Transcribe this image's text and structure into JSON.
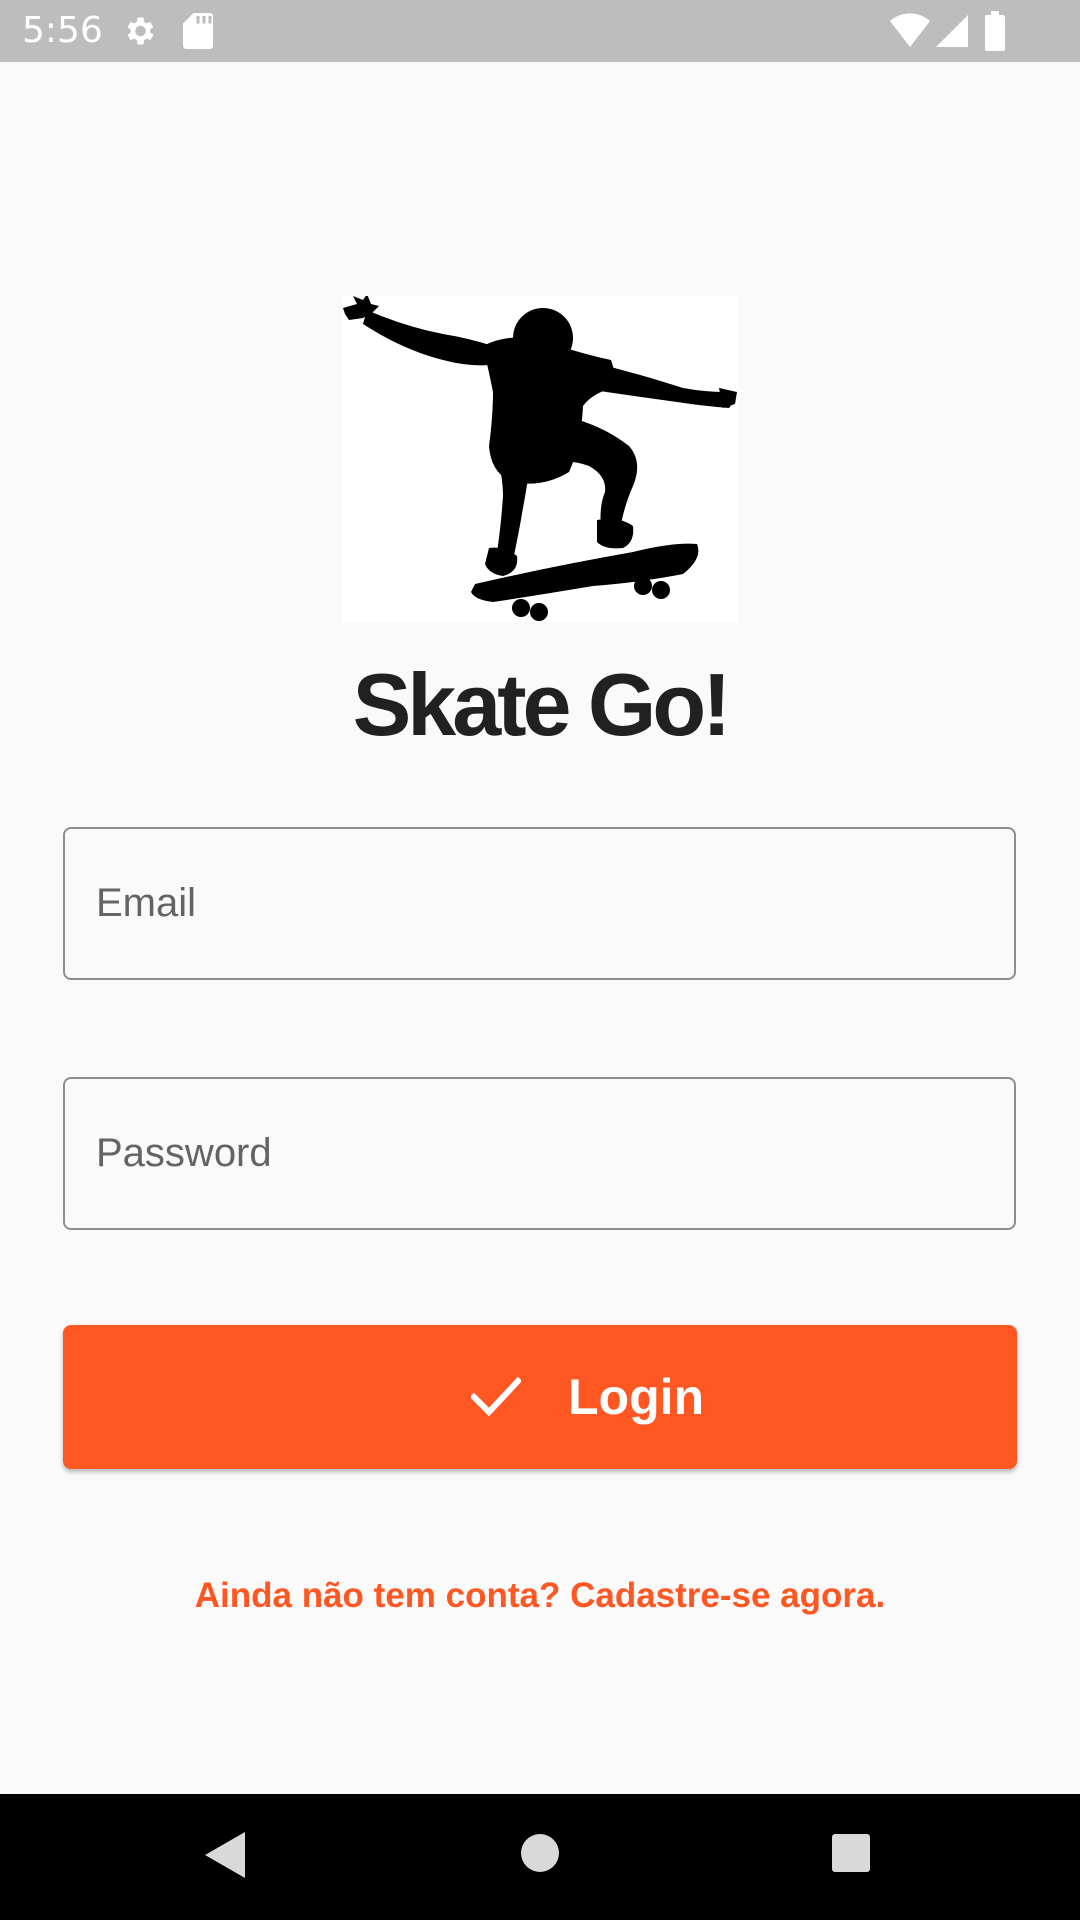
{
  "status_bar": {
    "time": "5:56",
    "icons": [
      "gear-icon",
      "sd-card-icon",
      "wifi-icon",
      "signal-icon",
      "battery-icon"
    ],
    "background": "#bdbdbd"
  },
  "logo": {
    "icon": "skateboarder-silhouette-icon"
  },
  "app_title": "Skate Go!",
  "form": {
    "email": {
      "value": "",
      "placeholder": "Email"
    },
    "password": {
      "value": "",
      "placeholder": "Password"
    },
    "login_button": {
      "icon": "check-icon",
      "label": "Login",
      "color": "#ff5722"
    }
  },
  "signup_link": "Ainda não tem conta? Cadastre-se agora.",
  "nav_bar": {
    "icons": [
      "back-icon",
      "home-icon",
      "recents-icon"
    ]
  },
  "colors": {
    "accent": "#ff5722",
    "title": "#212121",
    "background": "#fafafa"
  }
}
